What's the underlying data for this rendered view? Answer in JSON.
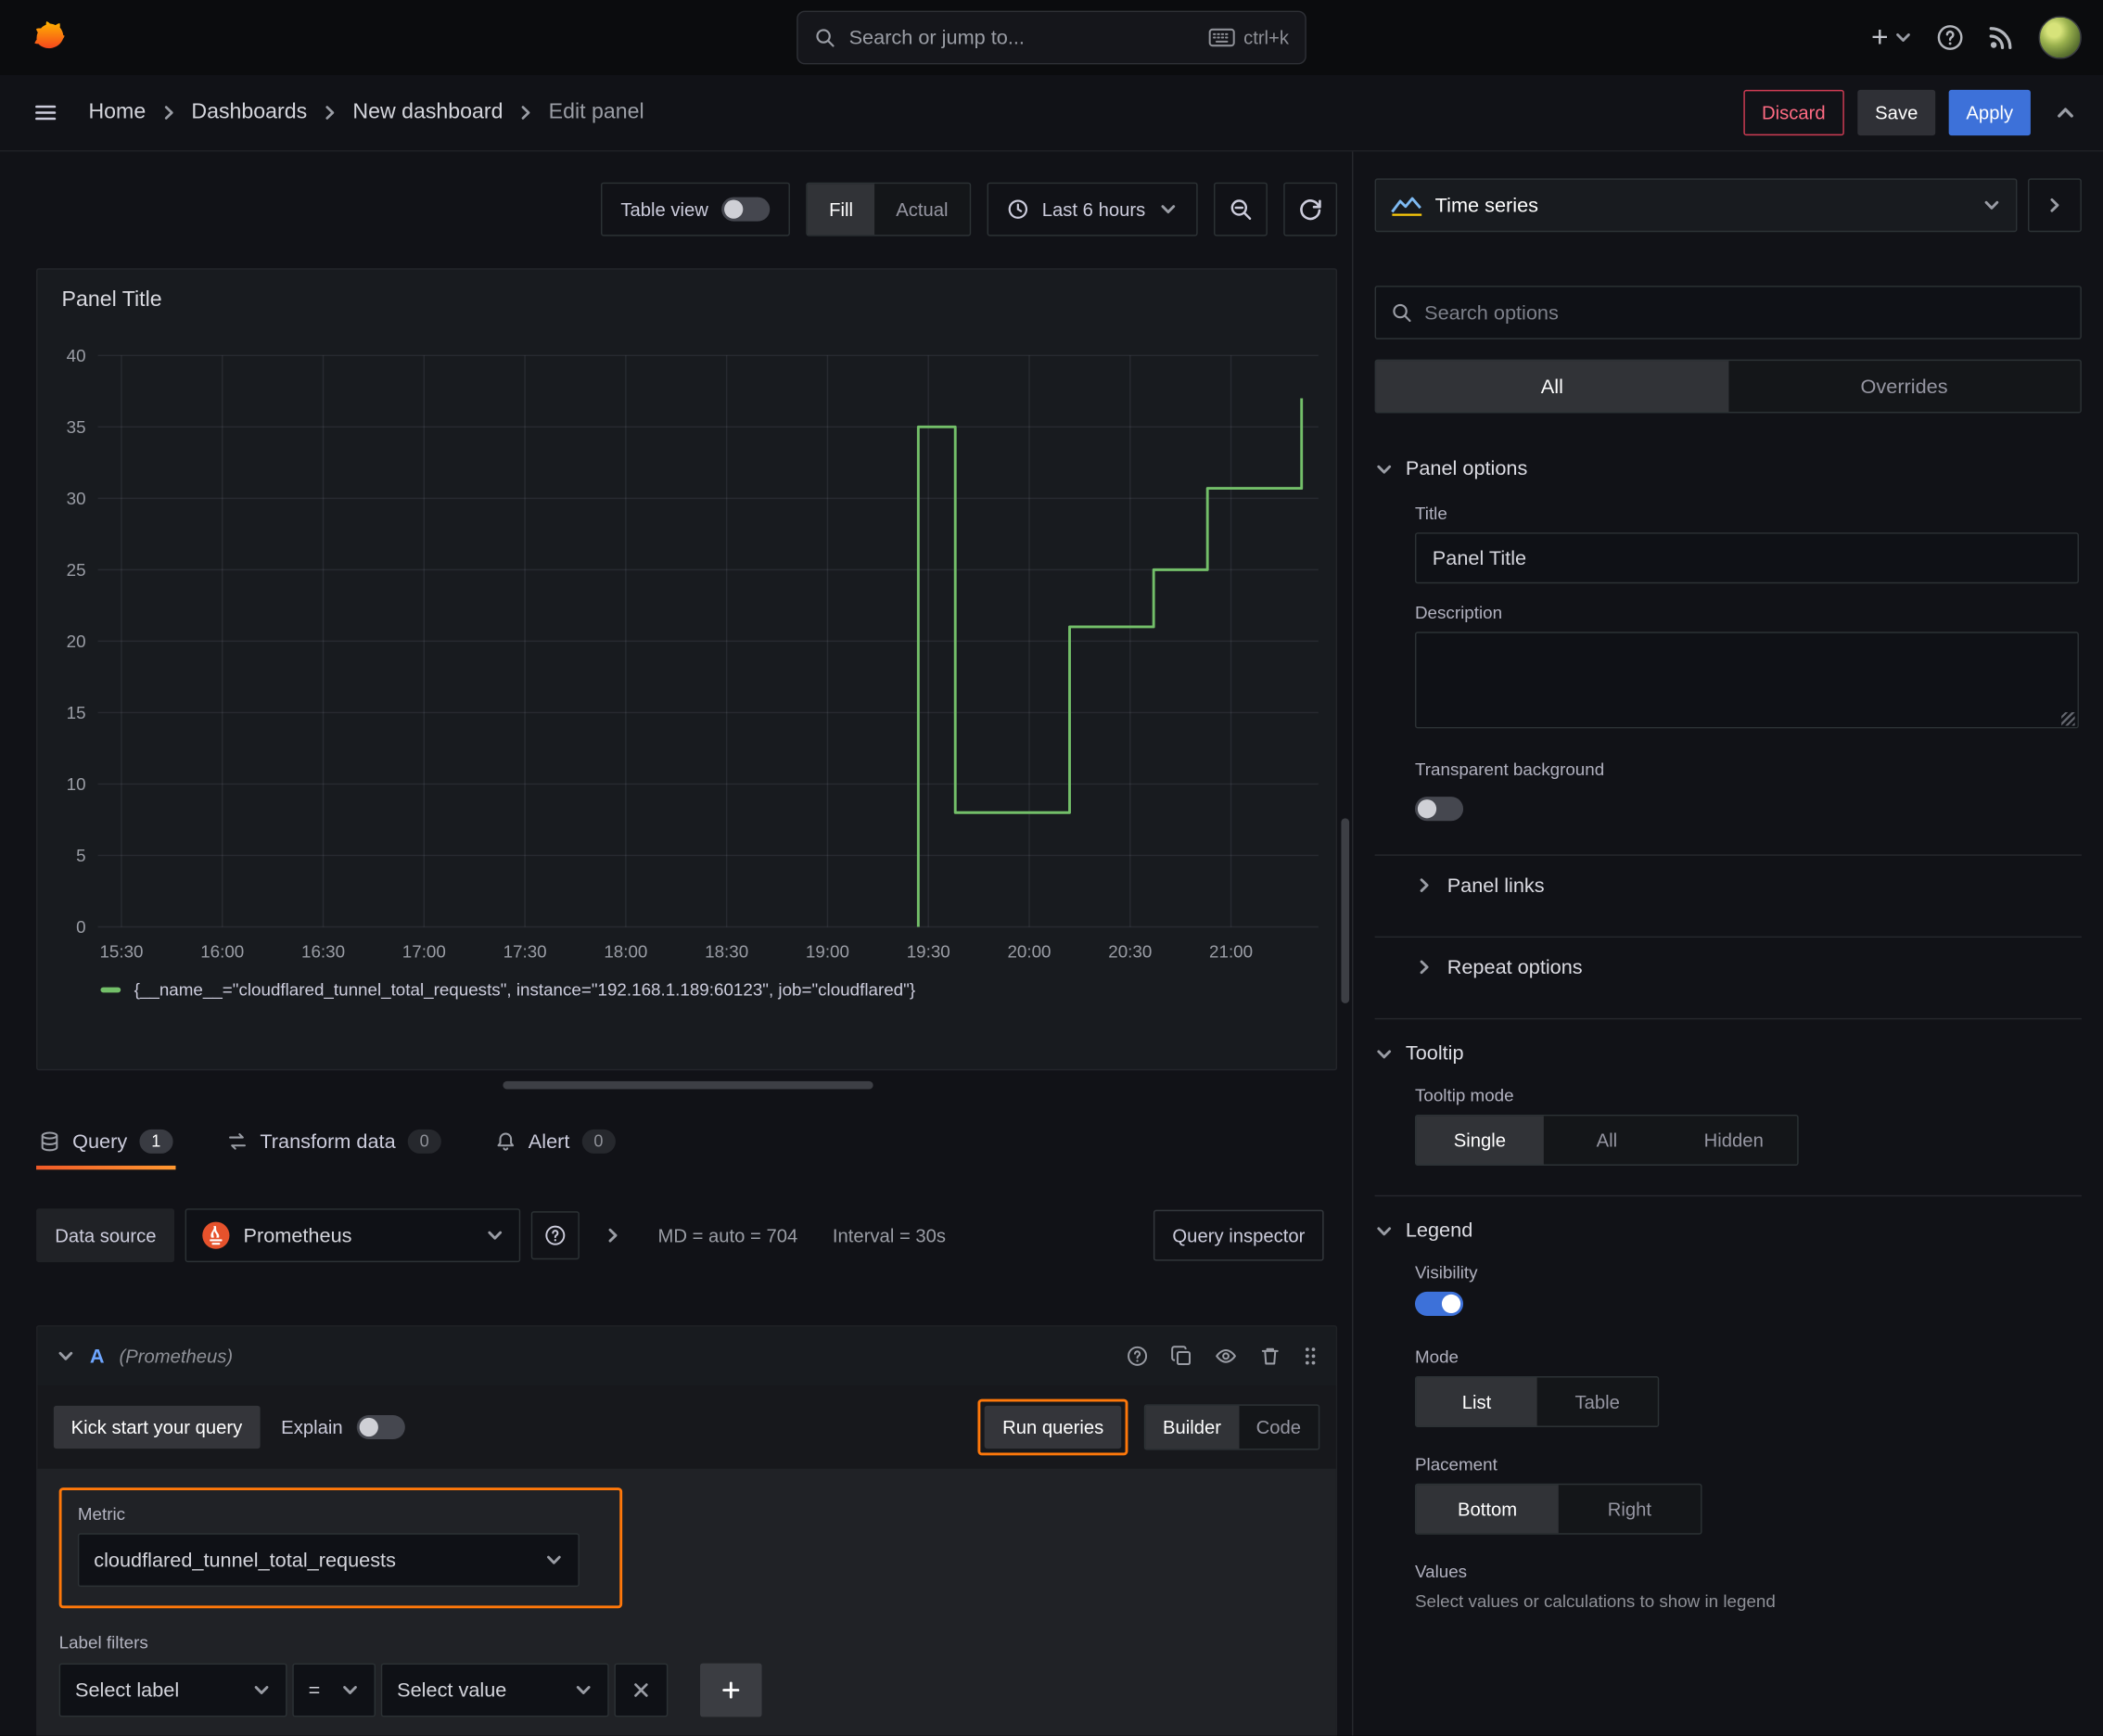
{
  "colors": {
    "accent_orange": "#ff780a",
    "primary_blue": "#3d71d9",
    "series_green": "#73bf69",
    "danger_red": "#f2495c"
  },
  "topbar": {
    "search_placeholder": "Search or jump to...",
    "shortcut_hint": "ctrl+k"
  },
  "breadcrumbs": {
    "items": [
      "Home",
      "Dashboards",
      "New dashboard",
      "Edit panel"
    ]
  },
  "nav_actions": {
    "discard": "Discard",
    "save": "Save",
    "apply": "Apply"
  },
  "toolbar": {
    "table_view": "Table view",
    "fill": "Fill",
    "actual": "Actual",
    "time_range": "Last 6 hours"
  },
  "panel": {
    "title": "Panel Title"
  },
  "chart_data": {
    "type": "line",
    "mode": "stepped",
    "title": "Panel Title",
    "x_ticks": [
      "15:30",
      "16:00",
      "16:30",
      "17:00",
      "17:30",
      "18:00",
      "18:30",
      "19:00",
      "19:30",
      "20:00",
      "20:30",
      "21:00"
    ],
    "y_ticks": [
      0,
      5,
      10,
      15,
      20,
      25,
      30,
      35,
      40
    ],
    "ylim": [
      0,
      40
    ],
    "x_domain": [
      "15:23",
      "21:26"
    ],
    "grid": true,
    "legend_position": "bottom",
    "series": [
      {
        "name": "{__name__=\"cloudflared_tunnel_total_requests\", instance=\"192.168.1.189:60123\", job=\"cloudflared\"}",
        "color": "#73bf69",
        "points": [
          [
            "19:27",
            0
          ],
          [
            "19:27",
            35
          ],
          [
            "19:38",
            35
          ],
          [
            "19:38",
            8
          ],
          [
            "20:12",
            8
          ],
          [
            "20:12",
            21
          ],
          [
            "20:37",
            21
          ],
          [
            "20:37",
            25
          ],
          [
            "20:53",
            25
          ],
          [
            "20:53",
            30.7
          ],
          [
            "21:21",
            30.7
          ],
          [
            "21:21",
            37
          ]
        ]
      }
    ]
  },
  "tabs": {
    "query": "Query",
    "query_count": "1",
    "transform": "Transform data",
    "transform_count": "0",
    "alert": "Alert",
    "alert_count": "0"
  },
  "datasource_row": {
    "label": "Data source",
    "value": "Prometheus",
    "md_stat": "MD = auto = 704",
    "interval_stat": "Interval = 30s",
    "inspector": "Query inspector"
  },
  "query_editor": {
    "ref_id": "A",
    "ds_name": "(Prometheus)",
    "kickstart": "Kick start your query",
    "explain": "Explain",
    "run_queries": "Run queries",
    "builder": "Builder",
    "code": "Code",
    "metric_label": "Metric",
    "metric_value": "cloudflared_tunnel_total_requests",
    "label_filters": "Label filters",
    "select_label": "Select label",
    "operator": "=",
    "select_value": "Select value"
  },
  "viz_picker": {
    "name": "Time series"
  },
  "options_pane": {
    "search_placeholder": "Search options",
    "filter_tabs": {
      "all": "All",
      "overrides": "Overrides"
    },
    "panel_options": {
      "heading": "Panel options",
      "title_label": "Title",
      "title_value": "Panel Title",
      "description_label": "Description",
      "transparent_label": "Transparent background",
      "panel_links": "Panel links",
      "repeat_options": "Repeat options"
    },
    "tooltip": {
      "heading": "Tooltip",
      "mode_label": "Tooltip mode",
      "options": [
        "Single",
        "All",
        "Hidden"
      ],
      "selected": "Single"
    },
    "legend": {
      "heading": "Legend",
      "visibility_label": "Visibility",
      "mode_label": "Mode",
      "mode_options": [
        "List",
        "Table"
      ],
      "placement_label": "Placement",
      "placement_options": [
        "Bottom",
        "Right"
      ],
      "values_label": "Values",
      "values_description": "Select values or calculations to show in legend"
    }
  }
}
